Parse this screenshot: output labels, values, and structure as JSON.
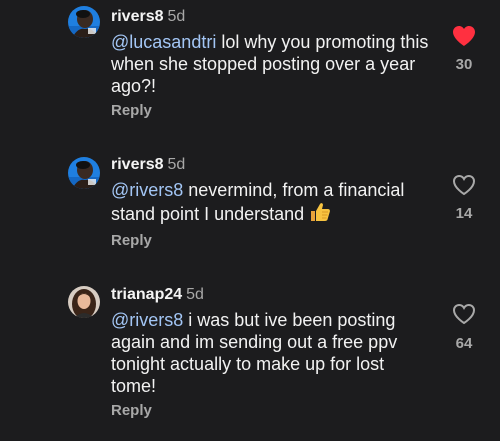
{
  "comments": [
    {
      "username": "rivers8",
      "time": "5d",
      "mention": "@lucasandtri",
      "text": " lol why you promoting this when she stopped posting over a year ago?!",
      "reply_label": "Reply",
      "likes": "30",
      "liked": true,
      "avatar": "blue-profile-avatar"
    },
    {
      "username": "rivers8",
      "time": "5d",
      "mention": "@rivers8",
      "text": " nevermind, from a financial stand point I understand ",
      "emoji": "thumbs-up-emoji",
      "reply_label": "Reply",
      "likes": "14",
      "liked": false,
      "avatar": "blue-profile-avatar"
    },
    {
      "username": "trianap24",
      "time": "5d",
      "mention": "@rivers8",
      "text": " i was but ive been posting again and im sending out a free ppv tonight actually to make up for lost tome!",
      "reply_label": "Reply",
      "likes": "64",
      "liked": false,
      "avatar": "woman-profile-avatar"
    }
  ],
  "colors": {
    "background": "#1c1c1e",
    "mention": "#a3c6f5",
    "liked_heart": "#ff3040",
    "secondary_text": "#a8a8a8"
  }
}
